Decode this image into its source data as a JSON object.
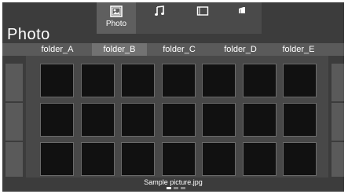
{
  "media_bar": {
    "tabs": [
      {
        "icon": "photo-icon",
        "label": "Photo",
        "active": true
      },
      {
        "icon": "music-note-icon",
        "label": "",
        "active": false
      },
      {
        "icon": "video-frame-icon",
        "label": "",
        "active": false
      },
      {
        "icon": "text-file-icon",
        "label": "",
        "active": false
      }
    ]
  },
  "page_title": "Photo",
  "folders": [
    {
      "label": "folder_A",
      "active": false
    },
    {
      "label": "folder_B",
      "active": true
    },
    {
      "label": "folder_C",
      "active": false
    },
    {
      "label": "folder_D",
      "active": false
    },
    {
      "label": "folder_E",
      "active": false
    }
  ],
  "grid": {
    "rows": 3,
    "columns": 7
  },
  "status": {
    "filename": "Sample picture.jpg",
    "pages": 3,
    "current_page": 1
  },
  "colors": {
    "background": "#3c3c3c",
    "active_tab": "#727272",
    "thumbnail": "#111111"
  }
}
